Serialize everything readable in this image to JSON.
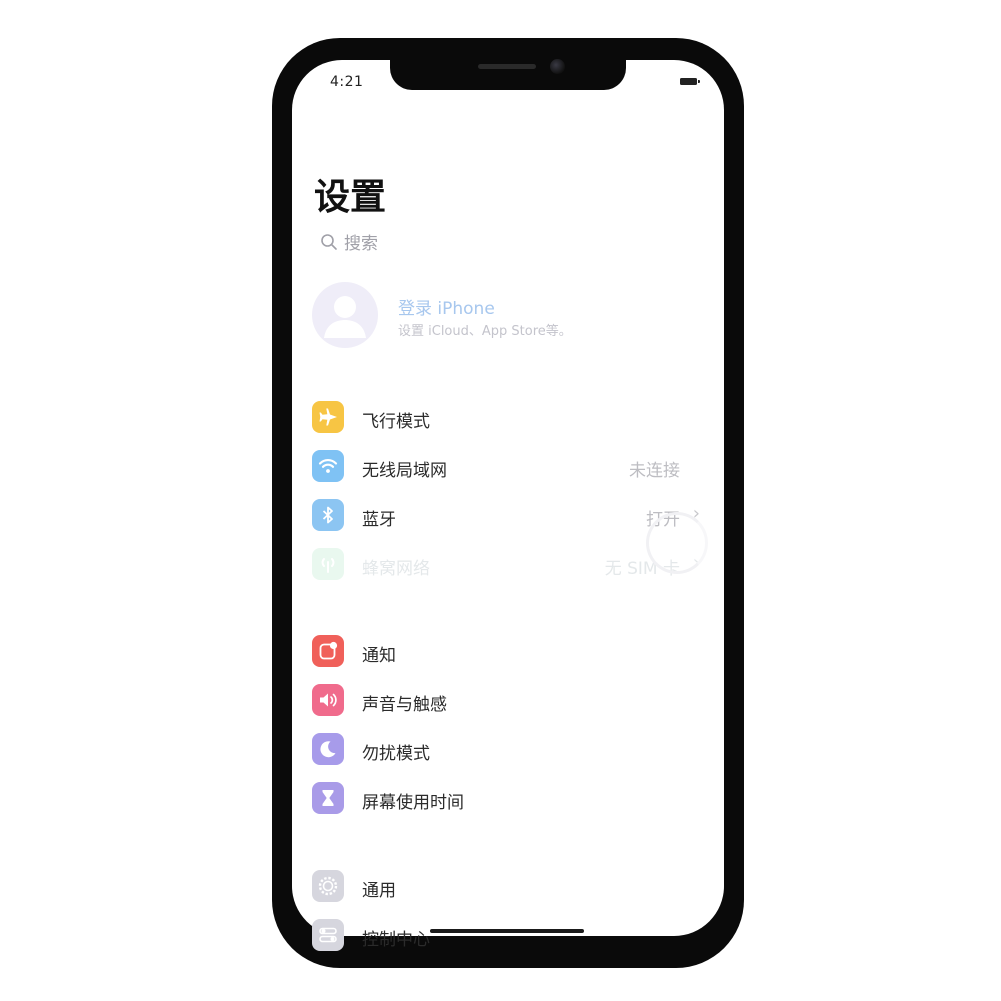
{
  "status_bar": {
    "time": "4:21"
  },
  "page_title": "设置",
  "search": {
    "placeholder": "搜索"
  },
  "profile": {
    "name": "登录 iPhone",
    "subtitle": "设置 iCloud、App Store等。"
  },
  "settings_groups": [
    {
      "items": [
        {
          "label": "飞行模式",
          "icon": "airplane-icon",
          "color": "#f7c544",
          "value": "",
          "chevron": ""
        },
        {
          "label": "无线局域网",
          "icon": "wifi-icon",
          "color": "#7fc2f4",
          "value": "未连接",
          "chevron": ""
        },
        {
          "label": "蓝牙",
          "icon": "bluetooth-icon",
          "color": "#8cc5f2",
          "value": "打开",
          "chevron": "›"
        },
        {
          "label": "蜂窝网络",
          "icon": "antenna-icon",
          "color": "#e9f8ef",
          "value": "无 SIM 卡",
          "chevron": "›"
        }
      ]
    },
    {
      "items": [
        {
          "label": "通知",
          "icon": "notification-icon",
          "color": "#f0605a"
        },
        {
          "label": "声音与触感",
          "icon": "speaker-icon",
          "color": "#f06b8c"
        },
        {
          "label": "勿扰模式",
          "icon": "moon-icon",
          "color": "#a79bea"
        },
        {
          "label": "屏幕使用时间",
          "icon": "hourglass-icon",
          "color": "#a99be8"
        }
      ]
    },
    {
      "items": [
        {
          "label": "通用",
          "icon": "gear-icon",
          "color": "#d6d6de"
        },
        {
          "label": "控制中心",
          "icon": "toggles-icon",
          "color": "#d6d6de"
        }
      ]
    }
  ]
}
